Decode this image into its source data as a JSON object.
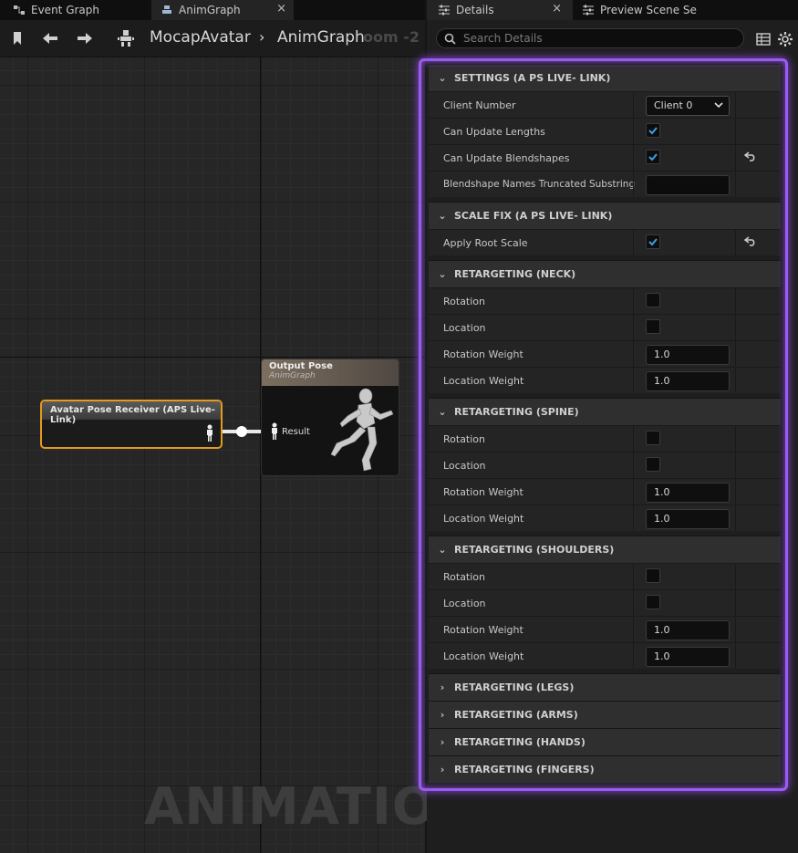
{
  "left_tabs": {
    "event_graph": "Event Graph",
    "anim_graph": "AnimGraph",
    "close": "×"
  },
  "breadcrumb": {
    "root": "MocapAvatar",
    "current": "AnimGraph",
    "zoom": "oom -2"
  },
  "graph": {
    "watermark": "ANIMATION",
    "receiver_node": {
      "title": "Avatar Pose Receiver (APS Live-Link)"
    },
    "output_node": {
      "title": "Output Pose",
      "subtitle": "AnimGraph",
      "pin_label": "Result"
    }
  },
  "right_tabs": {
    "details": "Details",
    "preview": "Preview Scene Se",
    "close": "×"
  },
  "search": {
    "placeholder": "Search Details"
  },
  "details": {
    "settings": {
      "title": "SETTINGS (A PS LIVE- LINK)",
      "client_number_label": "Client Number",
      "client_number_value": "Client 0",
      "can_update_lengths_label": "Can Update Lengths",
      "can_update_lengths": true,
      "can_update_blendshapes_label": "Can Update Blendshapes",
      "can_update_blendshapes": true,
      "blendshape_trunc_label": "Blendshape Names Truncated Substring",
      "blendshape_trunc_value": ""
    },
    "scale_fix": {
      "title": "SCALE FIX (A PS LIVE- LINK)",
      "apply_root_scale_label": "Apply Root Scale",
      "apply_root_scale": true
    },
    "neck": {
      "title": "RETARGETING (NECK)",
      "rotation": "Rotation",
      "location": "Location",
      "rotation_weight": "Rotation Weight",
      "rotation_weight_value": "1.0",
      "location_weight": "Location Weight",
      "location_weight_value": "1.0"
    },
    "spine": {
      "title": "RETARGETING (SPINE)",
      "rotation": "Rotation",
      "location": "Location",
      "rotation_weight": "Rotation Weight",
      "rotation_weight_value": "1.0",
      "location_weight": "Location Weight",
      "location_weight_value": "1.0"
    },
    "shoulders": {
      "title": "RETARGETING (SHOULDERS)",
      "rotation": "Rotation",
      "location": "Location",
      "rotation_weight": "Rotation Weight",
      "rotation_weight_value": "1.0",
      "location_weight": "Location Weight",
      "location_weight_value": "1.0"
    },
    "collapsed": {
      "legs": "RETARGETING (LEGS)",
      "arms": "RETARGETING (ARMS)",
      "hands": "RETARGETING (HANDS)",
      "fingers": "RETARGETING (FINGERS)"
    }
  },
  "colors": {
    "accent_checkbox": "#3aa0e8",
    "node_selected": "#e39a1e",
    "highlight": "#9a5cf0"
  }
}
